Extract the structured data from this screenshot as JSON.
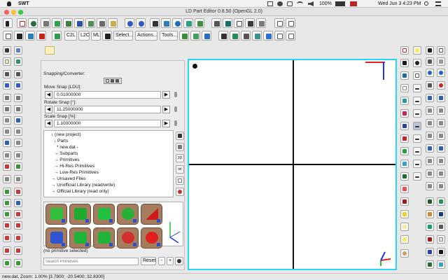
{
  "menubar": {
    "app_name": "SWT",
    "battery": "100%",
    "clock": "Wed Jun 3  4:23 PM"
  },
  "window": {
    "title": "LD Part Editor 0.8.50 (OpenGL 2.0)"
  },
  "toolbar": {
    "text_buttons": [
      "C2L",
      "L2C",
      "ML",
      "Select...",
      "Actions...",
      "Tools..."
    ]
  },
  "snap": {
    "header": "Snapping/Converter:",
    "move_label": "Move Snap [LDU]:",
    "move_value": "0.01000000",
    "rotate_label": "Rotate Snap [°]:",
    "rotate_value": "11.25000000",
    "scale_label": "Scale Snap [%]:",
    "scale_value": "1.10000000"
  },
  "tree": {
    "items": [
      "↓ (new project)",
      "↓ Parts",
      "* new.dat -",
      "→ Subparts",
      "→ Primitives",
      "→ Hi-Res Primitives",
      "→ Low-Res Primitives",
      "→ Unsaved Files",
      "→ Unofficial Library (read/write)",
      "→ Official Library (read only)"
    ],
    "side_labels": [
      "3D",
      "txt"
    ]
  },
  "primitives": {
    "status": "(no primitive selected)",
    "search_placeholder": "Search Primitives",
    "reset_label": "Reset",
    "minus_label": "-",
    "plus_label": "+"
  },
  "statusbar": {
    "text": "new.dat, Zoom: 1.00% [3.7800; -20.5400; 32.8300]"
  },
  "colors": {
    "viewport_border": "#29d4f4",
    "axis_red": "#e02020",
    "axis_blue": "#2038e0",
    "axis_green": "#20c040",
    "primitive_tile": "#a57d5e",
    "palette": [
      "#1a1a1a",
      "#f2ec6a",
      "#1f6e9e",
      "#ffffff",
      "#2a9a9e",
      "#f0f0f0",
      "#c92060",
      "#2f3fa8",
      "#e0e0e0",
      "#c82424",
      "#2a9e3a",
      "#36a0d0",
      "#f4ec9a",
      "#1e6e2e",
      "#10a070",
      "#ef4a4a",
      "#cf8a2a",
      "#a01818",
      "#1d5b2b",
      "#2e8e5e",
      "#f2d41a",
      "#123a88",
      "#5a5a5a"
    ]
  },
  "icons": [
    "gear-icon",
    "arrow-left-icon",
    "arrow-right-icon",
    "pin-icon",
    "undo-icon",
    "redo-icon",
    "eye-icon"
  ]
}
